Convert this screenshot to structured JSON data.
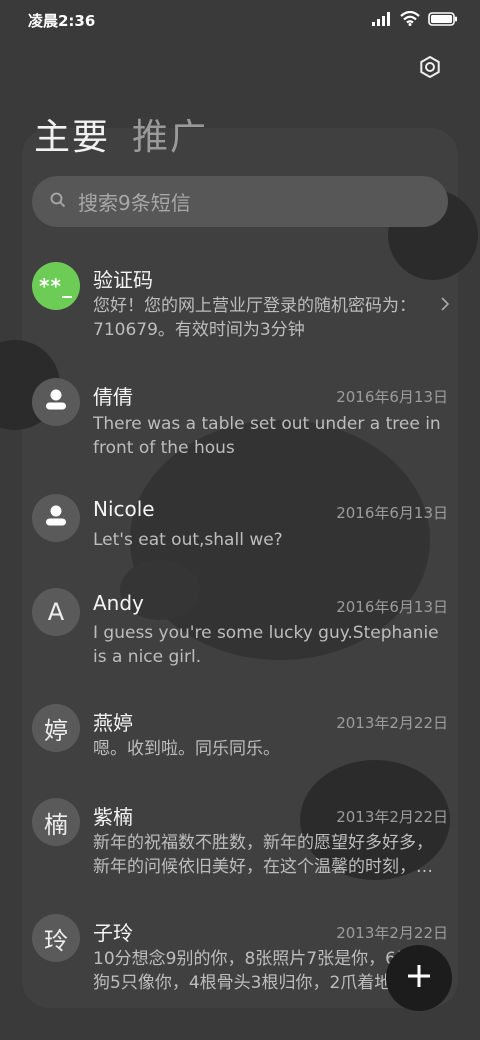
{
  "status_bar": {
    "time": "凌晨2:36"
  },
  "tabs": [
    {
      "label": "主要"
    },
    {
      "label": "推广"
    }
  ],
  "search": {
    "placeholder": "搜索9条短信"
  },
  "conversations": [
    {
      "avatar": "**_",
      "avatar_color": "#6ccc55",
      "name": "验证码",
      "date": "",
      "preview": "您好！您的网上营业厅登录的随机密码为：710679。有效时间为3分钟"
    },
    {
      "avatar_icon": "person-icon",
      "name": "倩倩",
      "date": "2016年6月13日",
      "preview": "There was a table set out under a tree in front of the hous"
    },
    {
      "avatar_icon": "person-icon",
      "name": "Nicole",
      "date": "2016年6月13日",
      "preview": "Let's eat out,shall we?"
    },
    {
      "avatar": "A",
      "name": "Andy",
      "date": "2016年6月13日",
      "preview": "I guess you're some lucky guy.Stephanie is a nice girl."
    },
    {
      "avatar": "婷",
      "name": "燕婷",
      "date": "2013年2月22日",
      "preview": "嗯。收到啦。同乐同乐。"
    },
    {
      "avatar": "楠",
      "name": "紫楠",
      "date": "2013年2月22日",
      "preview": "新年的祝福数不胜数，新年的愿望好多好多，新年的问候依旧美好，在这个温馨的时刻，…"
    },
    {
      "avatar": "玲",
      "name": "子玲",
      "date": "2013年2月22日",
      "preview": "10分想念9别的你，8张照片7张是你，6只小狗5只像你，4根骨头3根归你，2爪着地"
    }
  ],
  "colors": {
    "background": "#3a3a3a",
    "accent_green": "#6ccc55",
    "fab": "#1c1c1c"
  }
}
